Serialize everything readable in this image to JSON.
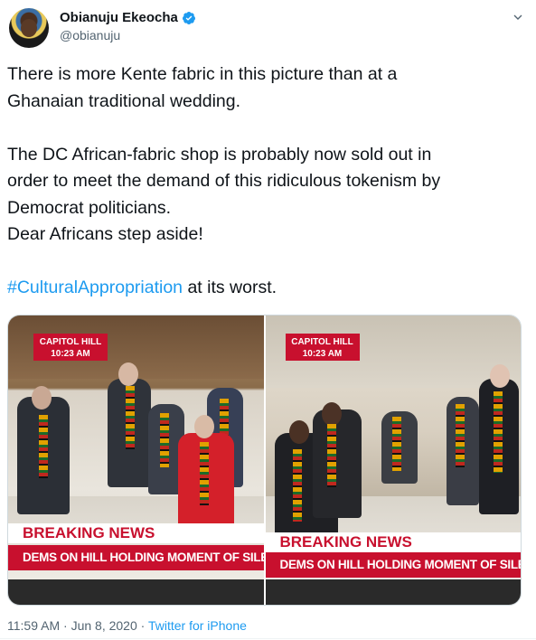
{
  "author": {
    "display_name": "Obianuju Ekeocha",
    "handle": "@obianuju",
    "verified": true
  },
  "tweet": {
    "lines": [
      "There is more Kente fabric in this picture than at a",
      "Ghanaian traditional wedding.",
      "",
      "The DC African-fabric shop is probably now sold out in",
      "order to meet the demand of this ridiculous tokenism by",
      "Democrat politicians.",
      "Dear Africans step aside!",
      ""
    ],
    "hashtag": "#CulturalAppropriation",
    "after_hashtag": " at its worst."
  },
  "media": {
    "left": {
      "location": "CAPITOL HILL",
      "time": "10:23 AM",
      "breaking": "BREAKING NEWS",
      "headline": "DEMS ON HILL HOLDING MOMENT OF SILENCE F"
    },
    "right": {
      "location": "CAPITOL HILL",
      "time": "10:23 AM",
      "breaking": "BREAKING NEWS",
      "headline": "DEMS ON HILL HOLDING MOMENT OF SILENCE F"
    }
  },
  "meta": {
    "time": "11:59 AM",
    "separator": " · ",
    "date": "Jun 8, 2020",
    "source": "Twitter for iPhone"
  },
  "colors": {
    "accent": "#1d9bf0",
    "chyron_red": "#c8102e",
    "text": "#0f1419",
    "muted": "#536471"
  },
  "icons": {
    "verified": "verified-badge-icon",
    "more": "chevron-down-icon"
  }
}
